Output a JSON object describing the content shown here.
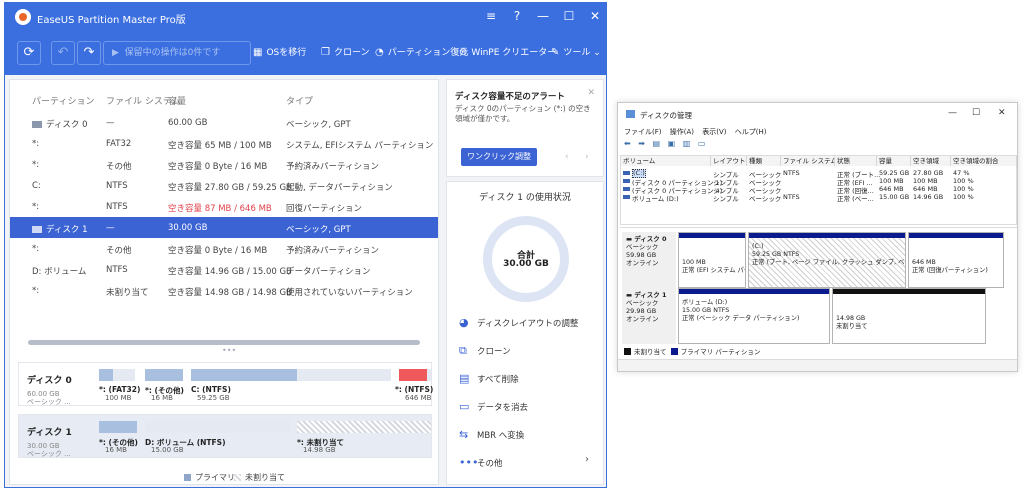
{
  "easeus": {
    "title": "EaseUS Partition Master Pro版",
    "window_buttons": [
      "≡",
      "?",
      "—",
      "☐",
      "✕"
    ],
    "toolbar": {
      "pending_label": "保留中の操作は0件です",
      "items": [
        {
          "icon": "grid-icon",
          "glyph": "▦",
          "label": "OSを移行"
        },
        {
          "icon": "copy-icon",
          "glyph": "❐",
          "label": "クローン"
        },
        {
          "icon": "restore-icon",
          "glyph": "◔",
          "label": "パーティション復元"
        },
        {
          "icon": "winpe-icon",
          "glyph": "⊙",
          "label": "WinPE クリエーター"
        },
        {
          "icon": "tools-icon",
          "glyph": "✎",
          "label": "ツール"
        }
      ]
    },
    "columns": [
      "パーティション",
      "ファイル システム",
      "容量",
      "タイプ"
    ],
    "rows": [
      {
        "name": "ディスク 0",
        "fs": "—",
        "cap": "60.00 GB",
        "type": "ベーシック, GPT",
        "disk": true,
        "selected": false,
        "warn": false
      },
      {
        "name": "*:",
        "fs": "FAT32",
        "cap": "空き容量 65 MB / 100 MB",
        "type": "システム, EFIシステム パーティション",
        "disk": false,
        "selected": false,
        "warn": false
      },
      {
        "name": "*:",
        "fs": "その他",
        "cap": "空き容量 0 Byte / 16 MB",
        "type": "予約済みパーティション",
        "disk": false,
        "selected": false,
        "warn": false
      },
      {
        "name": "C:",
        "fs": "NTFS",
        "cap": "空き容量 27.80 GB / 59.25 GB",
        "type": "起動, データパーティション",
        "disk": false,
        "selected": false,
        "warn": false
      },
      {
        "name": "*:",
        "fs": "NTFS",
        "cap": "空き容量 87 MB / 646 MB",
        "type": "回復パーティション",
        "disk": false,
        "selected": false,
        "warn": true
      },
      {
        "name": "ディスク 1",
        "fs": "—",
        "cap": "30.00 GB",
        "type": "ベーシック, GPT",
        "disk": true,
        "selected": true,
        "warn": false
      },
      {
        "name": "*:",
        "fs": "その他",
        "cap": "空き容量 0 Byte / 16 MB",
        "type": "予約済みパーティション",
        "disk": false,
        "selected": false,
        "warn": false
      },
      {
        "name": "D: ボリューム",
        "fs": "NTFS",
        "cap": "空き容量 14.96 GB / 15.00 GB",
        "type": "データパーティション",
        "disk": false,
        "selected": false,
        "warn": false
      },
      {
        "name": "*:",
        "fs": "未割り当て",
        "cap": "空き容量 14.98 GB / 14.98 GB",
        "type": "使用されていないパーティション",
        "disk": false,
        "selected": false,
        "warn": false
      }
    ],
    "disk_maps": [
      {
        "name": "ディスク 0",
        "size": "60.00 GB",
        "kind": "ベーシック ...",
        "segments": [
          {
            "label": "*: (FAT32)",
            "size": "100 MB",
            "color": "#a9bfe0",
            "fill": 0.4
          },
          {
            "label": "*: (その他)",
            "size": "16 MB",
            "color": "#a9bfe0",
            "fill": 1.0
          },
          {
            "label": "C: (NTFS)",
            "size": "59.25 GB",
            "color": "#a9bfe0",
            "fill": 0.53
          },
          {
            "label": "*: (NTFS)",
            "size": "646 MB",
            "color": "#f0595c",
            "fill": 0.87
          }
        ]
      },
      {
        "name": "ディスク 1",
        "size": "30.00 GB",
        "kind": "ベーシック ...",
        "segments": [
          {
            "label": "*: (その他)",
            "size": "16 MB",
            "color": "#a9bfe0",
            "fill": 1.0
          },
          {
            "label": "D: ボリューム (NTFS)",
            "size": "15.00 GB",
            "color": "#a9bfe0",
            "fill": 0.0
          },
          {
            "label": "*: 未割り当て",
            "size": "14.98 GB",
            "color": "hatch",
            "fill": 1.0
          }
        ]
      }
    ],
    "legend": {
      "primary": "プライマリ",
      "unallocated": "未割り当て"
    },
    "alert": {
      "title": "ディスク容量不足のアラート",
      "body": "ディスク 0のパーティション (*:) の空き領域が僅かです。",
      "button": "ワンクリック調整"
    },
    "usage": {
      "title": "ディスク 1 の使用状況",
      "total_label": "合計",
      "total_value": "30.00 GB",
      "actions": [
        {
          "icon": "layout-icon",
          "glyph": "◕",
          "label": "ディスクレイアウトの調整"
        },
        {
          "icon": "clone-icon",
          "glyph": "⧉",
          "label": "クローン"
        },
        {
          "icon": "delete-all-icon",
          "glyph": "▤",
          "label": "すべて削除"
        },
        {
          "icon": "wipe-icon",
          "glyph": "▭",
          "label": "データを消去"
        },
        {
          "icon": "convert-icon",
          "glyph": "⇆",
          "label": "MBR へ変換"
        },
        {
          "icon": "more-icon",
          "glyph": "•••",
          "label": "その他"
        }
      ]
    }
  },
  "diskmgmt": {
    "title": "ディスクの管理",
    "menu": [
      "ファイル(F)",
      "操作(A)",
      "表示(V)",
      "ヘルプ(H)"
    ],
    "columns": [
      "ボリューム",
      "レイアウト",
      "種類",
      "ファイル システム",
      "状態",
      "容量",
      "空き領域",
      "空き領域の割合"
    ],
    "volumes": [
      [
        "(C:)",
        "シンプル",
        "ベーシック",
        "NTFS",
        "正常 (ブート...",
        "59.25 GB",
        "27.80 GB",
        "47 %"
      ],
      [
        "(ディスク 0 パーティション 1)",
        "シンプル",
        "ベーシック",
        "",
        "正常 (EFI ...",
        "100 MB",
        "100 MB",
        "100 %"
      ],
      [
        "(ディスク 0 パーティション 4)",
        "シンプル",
        "ベーシック",
        "",
        "正常 (回復...",
        "646 MB",
        "646 MB",
        "100 %"
      ],
      [
        "ボリューム (D:)",
        "シンプル",
        "ベーシック",
        "NTFS",
        "正常 (ベー...",
        "15.00 GB",
        "14.96 GB",
        "100 %"
      ]
    ],
    "disks": [
      {
        "name": "ディスク 0",
        "kind": "ベーシック",
        "size": "59.98 GB",
        "status": "オンライン",
        "parts": [
          {
            "l1": "",
            "l2": "100 MB",
            "l3": "正常 (EFI システム パーティション)",
            "style": "blue"
          },
          {
            "l1": "(C:)",
            "l2": "59.25 GB NTFS",
            "l3": "正常 (ブート, ページ ファイル, クラッシュ ダンプ, ベーシック データ パーティション)",
            "style": "hatch"
          },
          {
            "l1": "",
            "l2": "646 MB",
            "l3": "正常 (回復パーティション)",
            "style": "blue"
          }
        ]
      },
      {
        "name": "ディスク 1",
        "kind": "ベーシック",
        "size": "29.98 GB",
        "status": "オンライン",
        "parts": [
          {
            "l1": "ボリューム (D:)",
            "l2": "15.00 GB NTFS",
            "l3": "正常 (ベーシック データ パーティション)",
            "style": "blue"
          },
          {
            "l1": "",
            "l2": "14.98 GB",
            "l3": "未割り当て",
            "style": "black"
          }
        ]
      }
    ],
    "legend": {
      "unallocated": "未割り当て",
      "primary": "プライマリ パーティション"
    }
  }
}
